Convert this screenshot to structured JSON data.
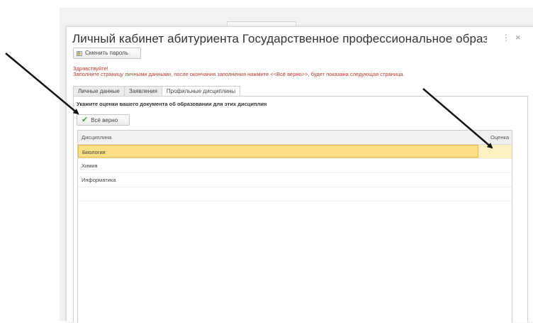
{
  "window": {
    "title": "Личный кабинет абитуриента Государственное профессиональное образовательное автономное уч...",
    "more_icon": "⋮",
    "close_icon": "×"
  },
  "change_password_button": {
    "label": "Сменить пароль",
    "icon": "password-change-icon"
  },
  "messages": {
    "greeting": "Здравствуйте!",
    "instruction": "Заполните страницу личными данными, после окончания заполнения нажмите <<Всё верно>>, будет показана следующая страница."
  },
  "tabs": [
    {
      "label": "Личные данные",
      "active": false
    },
    {
      "label": "Заявления",
      "active": false
    },
    {
      "label": "Профильные дисциплины",
      "active": true
    }
  ],
  "profile_disciplines": {
    "prompt": "Укажите оценки вашего документа об образовании для этих дисциплин",
    "confirm_button": {
      "label": "Всё верно",
      "icon": "checkmark-icon"
    },
    "table": {
      "columns": [
        "Дисциплина",
        "Оценка"
      ],
      "rows": [
        {
          "discipline": "Биология",
          "grade": "",
          "selected": true
        },
        {
          "discipline": "Химия",
          "grade": "",
          "selected": false
        },
        {
          "discipline": "Информатика",
          "grade": "",
          "selected": false
        }
      ]
    }
  },
  "colors": {
    "warning_text": "#c0392b",
    "selected_row": "#fcdf86",
    "selected_border": "#e8b949",
    "check_green": "#3fa33f"
  }
}
